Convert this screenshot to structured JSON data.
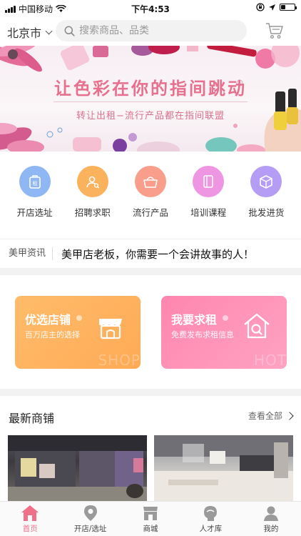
{
  "status_bar": {
    "carrier": "中国移动",
    "time": "下午4:53",
    "battery_level": 0.3
  },
  "header": {
    "city": "北京市",
    "search_placeholder": "搜索商品、品类"
  },
  "banner": {
    "title": "让色彩在你的指间跳动",
    "subtitle": "转让出租−流行产品都在指间联盟"
  },
  "quick_nav": [
    {
      "label": "开店选址",
      "icon": "shop-bag-icon",
      "color": "#8fb7f3"
    },
    {
      "label": "招聘求职",
      "icon": "person-search-icon",
      "color": "#fbb25c"
    },
    {
      "label": "流行产品",
      "icon": "basket-icon",
      "color": "#fa9e8c"
    },
    {
      "label": "培训课程",
      "icon": "book-icon",
      "color": "#ef96e3"
    },
    {
      "label": "批发进货",
      "icon": "box-icon",
      "color": "#b59cf5"
    }
  ],
  "news": {
    "tag": "美甲资讯",
    "headline": "美甲店老板，你需要一个会讲故事的人！"
  },
  "promo_cards": [
    {
      "title": "优选店铺",
      "subtitle": "百万店主的选择",
      "watermark": "SHOP"
    },
    {
      "title": "我要求租",
      "subtitle": "免费发布求租信息",
      "watermark": "HOT"
    }
  ],
  "shops_section": {
    "title": "最新商铺",
    "view_all": "查看全部"
  },
  "tabbar": [
    {
      "label": "首页",
      "icon": "home-icon",
      "active": true
    },
    {
      "label": "开店/选址",
      "icon": "location-pin-icon",
      "active": false
    },
    {
      "label": "商城",
      "icon": "store-icon",
      "active": false
    },
    {
      "label": "人才库",
      "icon": "talent-head-icon",
      "active": false
    },
    {
      "label": "我的",
      "icon": "user-icon",
      "active": false
    }
  ],
  "colors": {
    "accent": "#f0708a",
    "card_orange": "#ffb35f",
    "card_pink": "#ff8db3"
  }
}
